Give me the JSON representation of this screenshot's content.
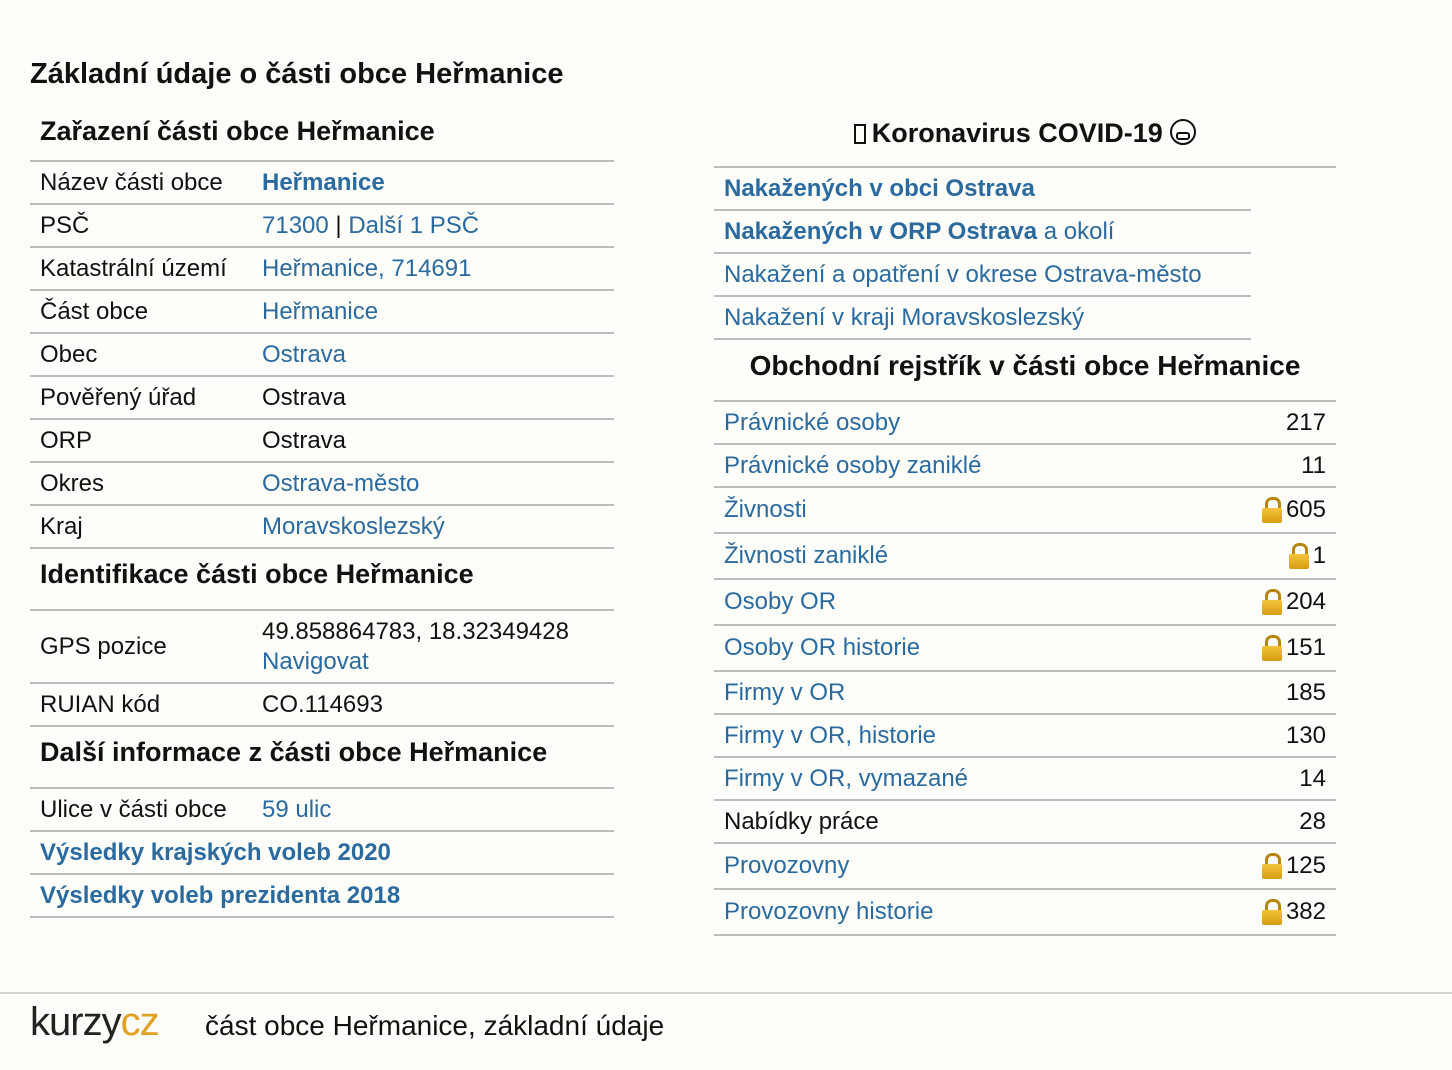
{
  "page_title": "Základní údaje o části obce Heřmanice",
  "zarazeni": {
    "heading": "Zařazení části obce Heřmanice",
    "rows": [
      {
        "label": "Název části obce",
        "value": "Heřmanice"
      },
      {
        "label": "PSČ",
        "value": "71300",
        "sep": " | ",
        "extra": "Další 1 PSČ"
      },
      {
        "label": "Katastrální území",
        "value": "Heřmanice, 714691"
      },
      {
        "label": "Část obce",
        "value": "Heřmanice"
      },
      {
        "label": "Obec",
        "value": "Ostrava"
      },
      {
        "label": "Pověřený úřad",
        "value": "Ostrava"
      },
      {
        "label": "ORP",
        "value": "Ostrava"
      },
      {
        "label": "Okres",
        "value": "Ostrava-město"
      },
      {
        "label": "Kraj",
        "value": "Moravskoslezský"
      }
    ]
  },
  "identifikace": {
    "heading": "Identifikace části obce Heřmanice",
    "gps_label": "GPS pozice",
    "gps_value": "49.858864783, 18.32349428",
    "gps_link": "Navigovat",
    "ruian_label": "RUIAN kód",
    "ruian_value": "CO.114693"
  },
  "dalsi": {
    "heading": "Další informace z části obce Heřmanice",
    "ulice_label": "Ulice v části obce",
    "ulice_value": "59 ulic",
    "volby_kraj": "Výsledky krajských voleb 2020",
    "volby_prezident": "Výsledky voleb prezidenta 2018"
  },
  "covid": {
    "heading": "Koronavirus COVID-19",
    "links": [
      {
        "bold": "Nakažených v obci Ostrava",
        "rest": ""
      },
      {
        "bold": "Nakažených v ORP Ostrava",
        "rest": " a okolí"
      },
      {
        "bold": "",
        "rest": "Nakažení a opatření v okrese Ostrava-město"
      },
      {
        "bold": "",
        "rest": "Nakažení v kraji Moravskoslezský"
      }
    ]
  },
  "rejstrik": {
    "heading": "Obchodní rejstřík v části obce Heřmanice",
    "rows": [
      {
        "label": "Právnické osoby",
        "count": "217",
        "locked": false,
        "link": true
      },
      {
        "label": "Právnické osoby zaniklé",
        "count": "11",
        "locked": false,
        "link": true
      },
      {
        "label": "Živnosti",
        "count": "605",
        "locked": true,
        "link": true
      },
      {
        "label": "Živnosti zaniklé",
        "count": "1",
        "locked": true,
        "link": true
      },
      {
        "label": "Osoby OR",
        "count": "204",
        "locked": true,
        "link": true
      },
      {
        "label": "Osoby OR historie",
        "count": "151",
        "locked": true,
        "link": true
      },
      {
        "label": "Firmy v OR",
        "count": "185",
        "locked": false,
        "link": true
      },
      {
        "label": "Firmy v OR, historie",
        "count": "130",
        "locked": false,
        "link": true
      },
      {
        "label": "Firmy v OR, vymazané",
        "count": "14",
        "locked": false,
        "link": true
      },
      {
        "label": "Nabídky práce",
        "count": "28",
        "locked": false,
        "link": false
      },
      {
        "label": "Provozovny",
        "count": "125",
        "locked": true,
        "link": true
      },
      {
        "label": "Provozovny historie",
        "count": "382",
        "locked": true,
        "link": true
      }
    ]
  },
  "footer": {
    "logo_kurzy": "kurzy",
    "logo_cz": "cz",
    "text": "část obce Heřmanice, základní údaje"
  },
  "colors": {
    "link": "#2b6a9e",
    "lock": "#e0a020",
    "background": "#fdfdf9"
  }
}
